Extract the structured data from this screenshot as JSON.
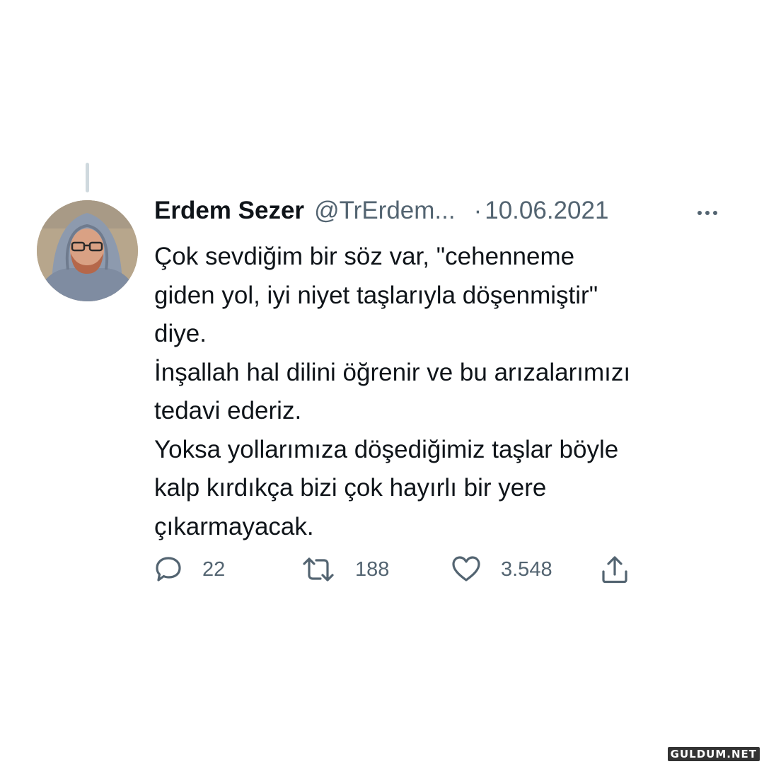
{
  "tweet": {
    "display_name": "Erdem Sezer",
    "handle": "@TrErdem...",
    "separator": "·",
    "date": "10.06.2021",
    "more_icon": "more-horizontal-icon",
    "lines": [
      "Çok sevdiğim bir söz var, \"cehenneme",
      "giden yol, iyi niyet taşlarıyla döşenmiştir\"",
      "diye.",
      "İnşallah hal dilini öğrenir ve bu arızalarımızı",
      "tedavi ederiz.",
      "Yoksa yollarımıza döşediğimiz taşlar böyle",
      "kalp kırdıkça bizi çok hayırlı bir yere",
      "çıkarmayacak."
    ]
  },
  "actions": {
    "reply": {
      "icon": "reply-icon",
      "count": "22"
    },
    "retweet": {
      "icon": "retweet-icon",
      "count": "188"
    },
    "like": {
      "icon": "heart-icon",
      "count": "3.548"
    },
    "share": {
      "icon": "share-icon"
    }
  },
  "watermark": "GULDUM.NET",
  "colors": {
    "text": "#0f1419",
    "secondary": "#536471",
    "thread_line": "#cfd9de",
    "background": "#ffffff"
  }
}
